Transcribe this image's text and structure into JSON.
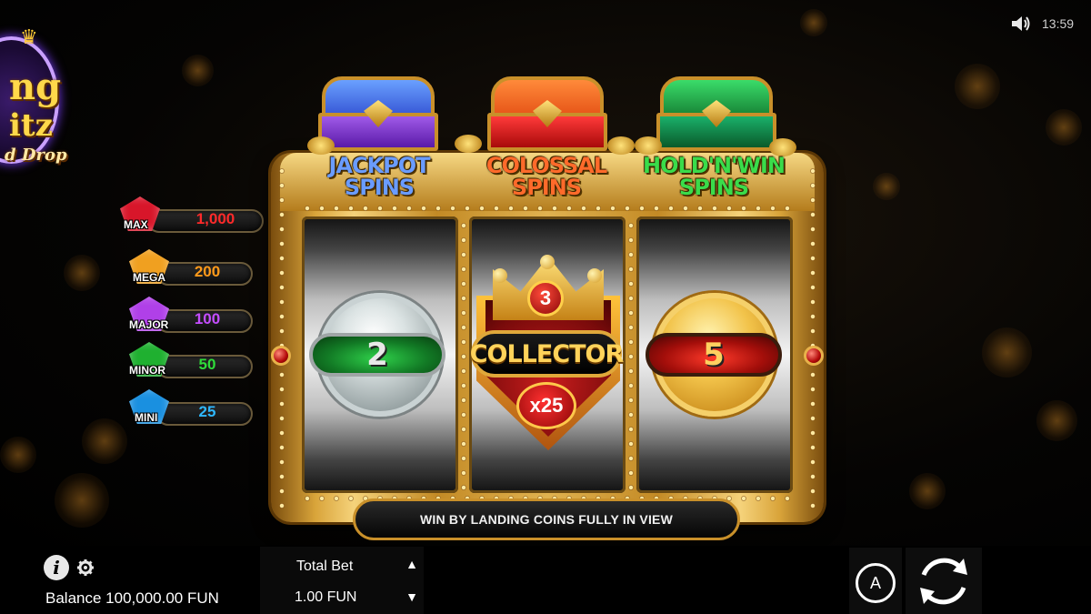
{
  "status": {
    "time": "13:59",
    "sound_icon": "speaker-icon"
  },
  "logo": {
    "line1": "ng",
    "line2": "itz",
    "line3": "d Drop"
  },
  "jackpots": [
    {
      "tier": "MAX",
      "value": "1,000",
      "color": "#ff2a2a",
      "gem": "#d8162a"
    },
    {
      "tier": "MEGA",
      "value": "200",
      "color": "#ff9a1a",
      "gem": "#f0a020"
    },
    {
      "tier": "MAJOR",
      "value": "100",
      "color": "#c44dff",
      "gem": "#b040e8"
    },
    {
      "tier": "MINOR",
      "value": "50",
      "color": "#2fdc3a",
      "gem": "#1fb030"
    },
    {
      "tier": "MINI",
      "value": "25",
      "color": "#2fb8ff",
      "gem": "#1a90e0"
    }
  ],
  "features": [
    {
      "line1": "JACKPOT",
      "line2": "SPINS",
      "color": "#5a8cff",
      "lid": "#3a5cd8",
      "body": "#8a3ad8"
    },
    {
      "line1": "COLOSSAL",
      "line2": "SPINS",
      "color": "#ff5a2a",
      "lid": "#e8581a",
      "body": "#d81a1a"
    },
    {
      "line1": "HOLD'N'WIN",
      "line2": "SPINS",
      "color": "#3adc4a",
      "lid": "#1aa83a",
      "body": "#0a7a3a"
    }
  ],
  "reels": {
    "reel1": {
      "coin": "silver",
      "value": "2"
    },
    "reel2": {
      "symbol": "COLLECTOR",
      "badge": "3",
      "multiplier": "x25"
    },
    "reel3": {
      "coin": "gold",
      "value": "5"
    }
  },
  "win_message": "WIN BY LANDING COINS FULLY IN VIEW",
  "hud": {
    "info_icon": "i",
    "balance": "Balance 100,000.00 FUN",
    "bet_label": "Total Bet",
    "bet_value": "1.00 FUN",
    "bet_up": "▲",
    "bet_down": "▼",
    "auto_label": "A"
  }
}
